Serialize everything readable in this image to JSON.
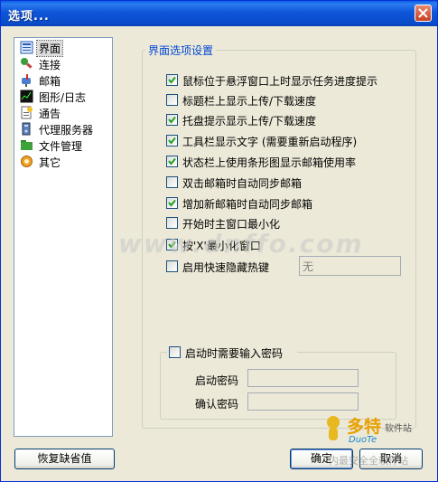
{
  "window": {
    "title": "选项..."
  },
  "nav": {
    "items": [
      {
        "label": "界面",
        "icon": "interface-icon",
        "selected": true
      },
      {
        "label": "连接",
        "icon": "plug-icon"
      },
      {
        "label": "邮箱",
        "icon": "mailbox-icon"
      },
      {
        "label": "图形/日志",
        "icon": "chart-icon"
      },
      {
        "label": "通告",
        "icon": "notice-icon"
      },
      {
        "label": "代理服务器",
        "icon": "proxy-icon"
      },
      {
        "label": "文件管理",
        "icon": "folder-icon"
      },
      {
        "label": "其它",
        "icon": "gear-icon"
      }
    ]
  },
  "interface_group": {
    "title": "界面选项设置",
    "options": [
      {
        "label": "鼠标位于悬浮窗口上时显示任务进度提示",
        "checked": true
      },
      {
        "label": "标题栏上显示上传/下载速度",
        "checked": false
      },
      {
        "label": "托盘提示显示上传/下载速度",
        "checked": true
      },
      {
        "label": "工具栏显示文字 (需要重新启动程序)",
        "checked": true
      },
      {
        "label": "状态栏上使用条形图显示邮箱使用率",
        "checked": true
      },
      {
        "label": "双击邮箱时自动同步邮箱",
        "checked": false
      },
      {
        "label": "增加新邮箱时自动同步邮箱",
        "checked": true
      },
      {
        "label": "开始时主窗口最小化",
        "checked": false
      },
      {
        "label": "按'X'最小化窗口",
        "checked": true
      },
      {
        "label": "启用快速隐藏热键",
        "checked": false
      }
    ],
    "hotkey_value": "无"
  },
  "password_group": {
    "title": "启动时需要输入密码",
    "checked": false,
    "startup_password_label": "启动密码",
    "confirm_password_label": "确认密码"
  },
  "buttons": {
    "restore_defaults": "恢复缺省值",
    "ok": "确定",
    "cancel": "取消"
  },
  "watermark": {
    "text": "www.dnffo.com",
    "logo_text": "多特",
    "logo_sub": "软件站",
    "logo_en": "DuoTe",
    "logo_footer": "内最安全全软件站"
  },
  "colors": {
    "titlebar": "#0a4cc9",
    "group_title": "#0046d5",
    "window_bg": "#ece9d8"
  }
}
